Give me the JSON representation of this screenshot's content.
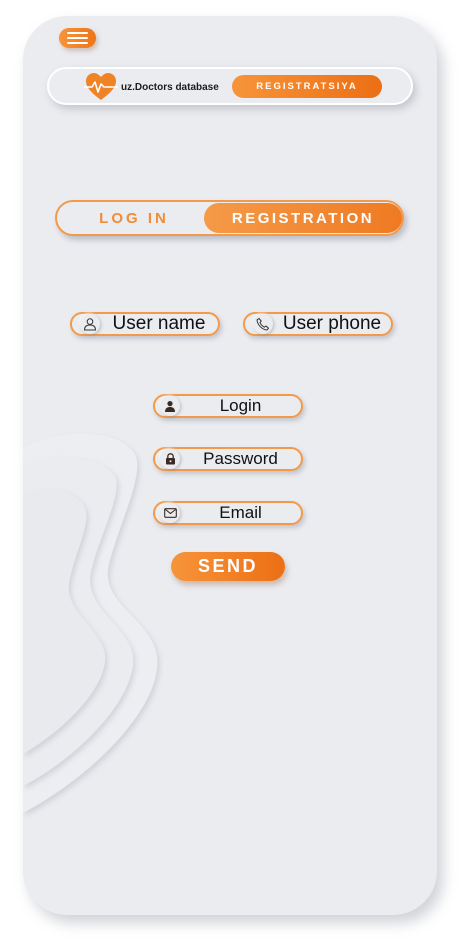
{
  "header": {
    "menu_icon": "hamburger-menu-icon",
    "logo_icon": "heart-pulse-icon",
    "brand_name": "uz.Doctors database",
    "register_button": "REGISTRATSIYA"
  },
  "auth_tabs": {
    "login_label": "LOG IN",
    "registration_label": "REGISTRATION",
    "active": "REGISTRATION"
  },
  "user_fields": [
    {
      "label": "User name",
      "icon": "person-icon"
    },
    {
      "label": "User phone",
      "icon": "phone-icon"
    }
  ],
  "form_fields": [
    {
      "label": "Login",
      "icon": "user-icon"
    },
    {
      "label": "Password",
      "icon": "lock-icon"
    },
    {
      "label": "Email",
      "icon": "envelope-icon"
    }
  ],
  "send_button": "SEND",
  "colors": {
    "accent": "#f08326",
    "accent_light": "#f7943a",
    "background": "#ebecf0"
  }
}
